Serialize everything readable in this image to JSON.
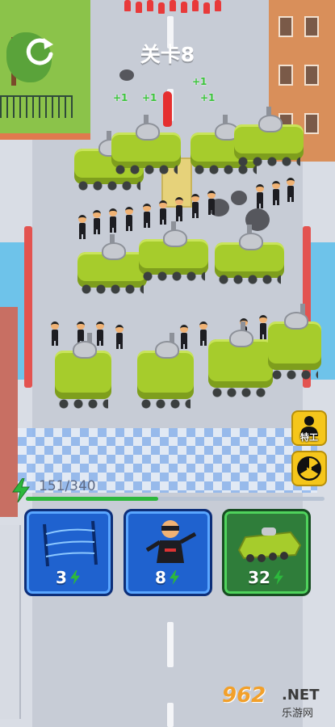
{
  "hud": {
    "level_label": "关卡8",
    "energy_text": "151/340",
    "energy_current": 151,
    "energy_max": 340
  },
  "buttons": {
    "special_label": "特工"
  },
  "cards": [
    {
      "name": "barbed-wire",
      "cost": "3",
      "style": "blue"
    },
    {
      "name": "ninja-agent",
      "cost": "8",
      "style": "blue"
    },
    {
      "name": "armored-tank",
      "cost": "32",
      "style": "green"
    }
  ],
  "field": {
    "plus_labels": [
      "+1",
      "+1",
      "+1",
      "+1"
    ]
  },
  "watermark": {
    "number": "962",
    "domain": ".NET",
    "text": "乐游网"
  },
  "colors": {
    "energy": "#2db83d",
    "enemy": "#e83a3a",
    "tank": "#a6cc2c",
    "card_blue": "#1f62cf",
    "card_green": "#2f7d3a",
    "special_button": "#f5c61b"
  },
  "icons": [
    "restart-icon",
    "lightning-icon",
    "soldier-silhouette-icon",
    "radiation-icon",
    "barbed-wire-icon",
    "ninja-icon",
    "tank-icon"
  ]
}
